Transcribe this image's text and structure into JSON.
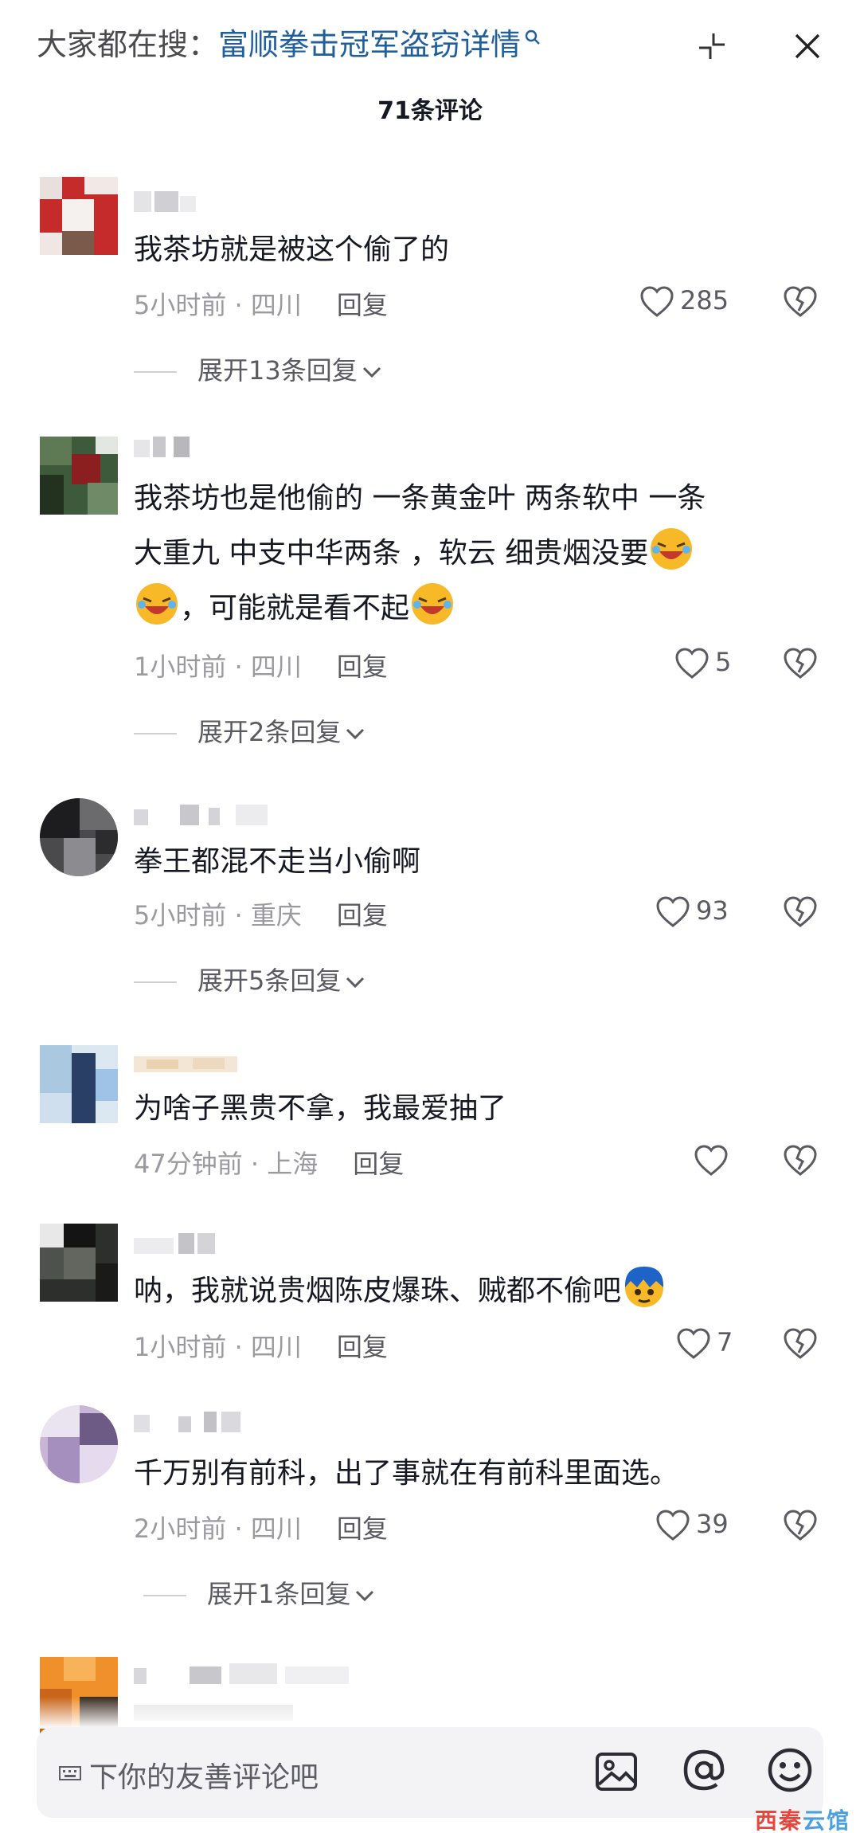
{
  "header": {
    "search_prefix": "大家都在搜：",
    "search_term": "富顺拳击冠军盗窃详情",
    "comment_count": "71条评论"
  },
  "comments": [
    {
      "text": "我茶坊就是被这个偷了的",
      "time": "5小时前",
      "location": "四川",
      "reply": "回复",
      "likes": "285",
      "expand": "展开13条回复"
    },
    {
      "text1": "我茶坊也是他偷的   一条黄金叶  两条软中  一条",
      "text2": "大重九   中支中华两条   ，软云  细贵烟没要",
      "text3": "，可能就是看不起",
      "time": "1小时前",
      "location": "四川",
      "reply": "回复",
      "likes": "5",
      "expand": "展开2条回复"
    },
    {
      "text": "拳王都混不走当小偷啊",
      "time": "5小时前",
      "location": "重庆",
      "reply": "回复",
      "likes": "93",
      "expand": "展开5条回复"
    },
    {
      "text": "为啥子黑贵不拿，我最爱抽了",
      "time": "47分钟前",
      "location": "上海",
      "reply": "回复",
      "likes": ""
    },
    {
      "text": "呐，我就说贵烟陈皮爆珠、贼都不偷吧",
      "time": "1小时前",
      "location": "四川",
      "reply": "回复",
      "likes": "7"
    },
    {
      "text": "千万别有前科，出了事就在有前科里面选。",
      "time": "2小时前",
      "location": "四川",
      "reply": "回复",
      "likes": "39",
      "expand": "展开1条回复"
    }
  ],
  "input": {
    "placeholder": "下你的友善评论吧"
  },
  "watermark": {
    "part1": "西秦",
    "part2": "云馆"
  },
  "icons": [
    "search-icon",
    "collapse-icon",
    "close-icon",
    "heart-icon",
    "broken-heart-icon",
    "chevron-down-icon",
    "keyboard-icon",
    "image-icon",
    "at-icon",
    "smiley-icon",
    "laughing-emoji-icon",
    "blue-hair-emoji-icon"
  ],
  "colors": {
    "search_term": "#1f5f9e",
    "meta": "#9a9aa0",
    "text": "#161823",
    "input_bg": "#f3f3f5"
  }
}
